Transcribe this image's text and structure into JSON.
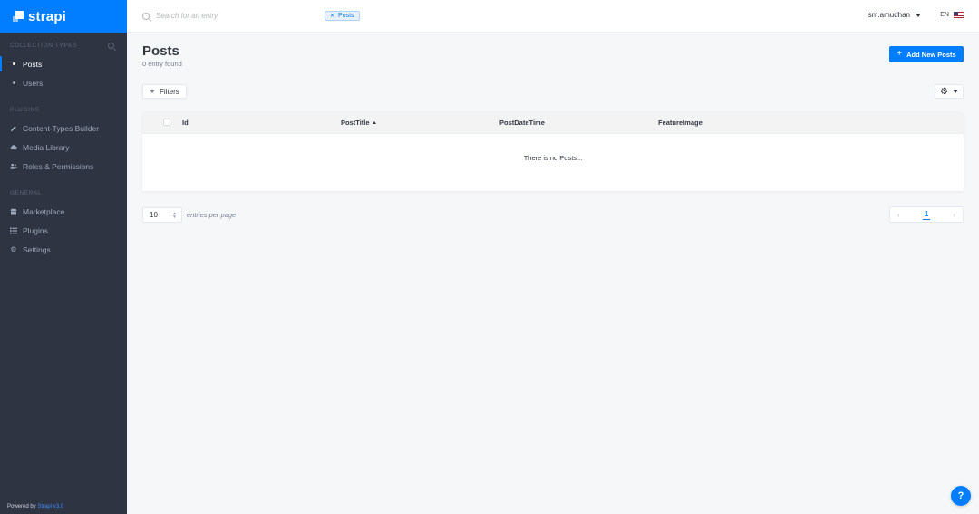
{
  "brand": {
    "name": "strapi"
  },
  "sidebar": {
    "collection_types_title": "Collection Types",
    "collection_types": [
      {
        "label": "Posts",
        "active": true
      },
      {
        "label": "Users",
        "active": false
      }
    ],
    "plugins_title": "Plugins",
    "plugins": [
      {
        "label": "Content-Types Builder",
        "icon": "pencil-icon"
      },
      {
        "label": "Media Library",
        "icon": "cloud-icon"
      },
      {
        "label": "Roles & Permissions",
        "icon": "users-icon"
      }
    ],
    "general_title": "General",
    "general": [
      {
        "label": "Marketplace",
        "icon": "shop-icon"
      },
      {
        "label": "Plugins",
        "icon": "list-icon"
      },
      {
        "label": "Settings",
        "icon": "gear-icon"
      }
    ],
    "powered_by": "Powered by",
    "version": "Strapi v3.0"
  },
  "topbar": {
    "search_placeholder": "Search for an entry",
    "filter_chip": "Posts",
    "username": "sm.amudhan",
    "language": "EN"
  },
  "main": {
    "title": "Posts",
    "entry_count": "0 entry found",
    "add_button": "Add New Posts",
    "filters_label": "Filters",
    "columns": [
      "Id",
      "PostTitle",
      "PostDateTime",
      "FeatureImage"
    ],
    "sorted_column": "PostTitle",
    "empty_message": "There is no Posts...",
    "page_size": "10",
    "per_page_label": "entries per page",
    "current_page": "1"
  },
  "colors": {
    "accent": "#007eff",
    "sidebar_bg": "#2e3442",
    "page_bg": "#f6f7f9"
  }
}
